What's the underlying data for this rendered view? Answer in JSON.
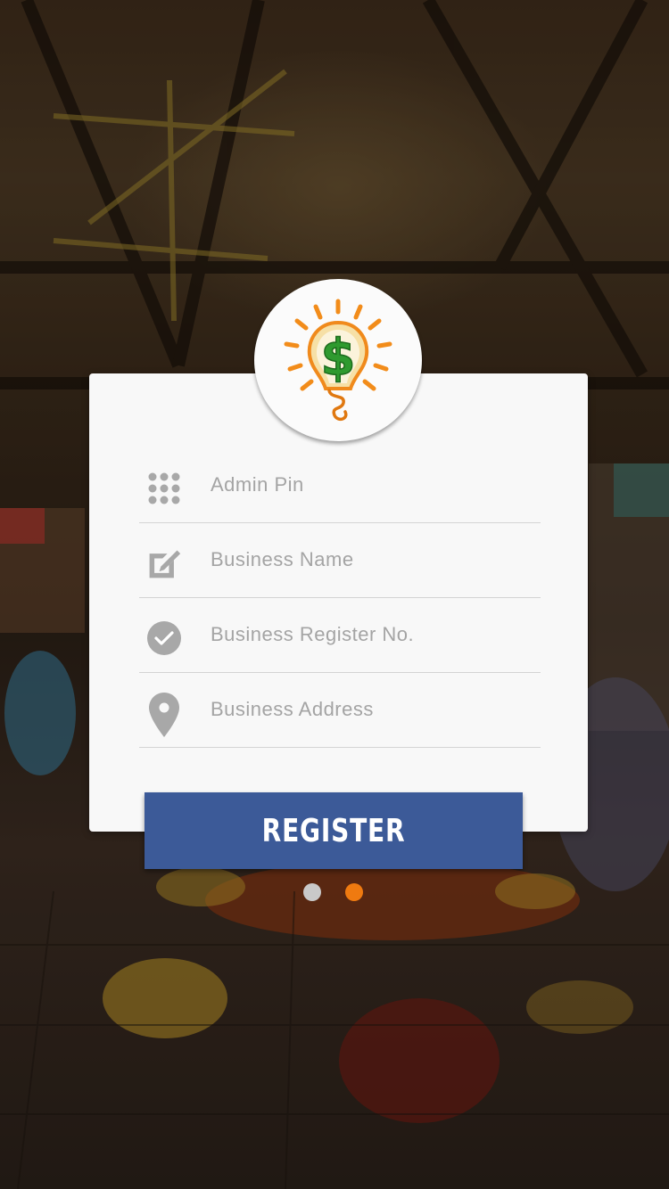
{
  "form": {
    "fields": [
      {
        "placeholder": "Admin Pin",
        "icon": "keypad-icon"
      },
      {
        "placeholder": "Business Name",
        "icon": "edit-icon"
      },
      {
        "placeholder": "Business Register No.",
        "icon": "check-circle-icon"
      },
      {
        "placeholder": "Business Address",
        "icon": "location-pin-icon"
      }
    ],
    "register_label": "REGISTER"
  },
  "logo": {
    "icon": "lightbulb-dollar-icon"
  },
  "pager": {
    "total": 2,
    "active_index": 1
  },
  "colors": {
    "button": "#3c5a98",
    "active_dot": "#ef7a10",
    "inactive_dot": "#c9c9c9",
    "icon_gray": "#a8a8a8"
  }
}
